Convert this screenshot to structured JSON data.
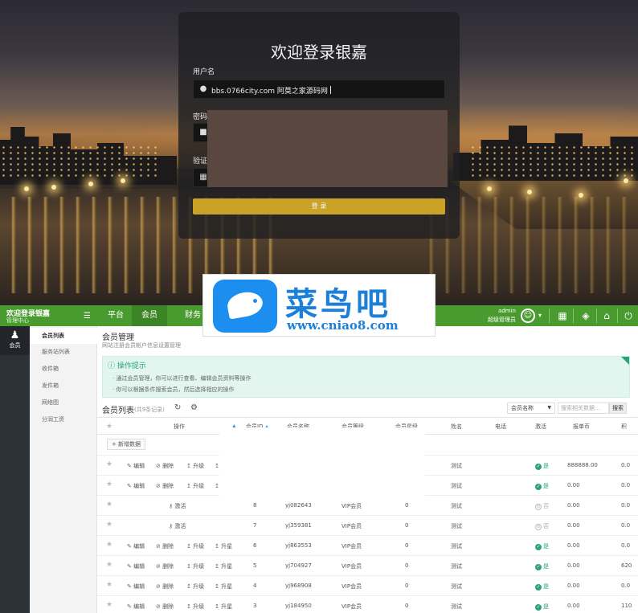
{
  "login": {
    "title": "欢迎登录银嘉",
    "username_label": "用户名",
    "username_value": "bbs.0766city.com   阿莫之家源码网",
    "password_label": "密码",
    "captcha_label": "验证",
    "submit_label": "登 录"
  },
  "watermark": {
    "title": "菜鸟吧",
    "url": "www.cniao8.com"
  },
  "header": {
    "brand_title": "欢迎登录银嘉",
    "brand_sub": "管理中心",
    "tabs": [
      "平台",
      "会员",
      "财务"
    ],
    "active_tab": "会员",
    "user_name": "admin",
    "user_role": "超级管理员"
  },
  "rail": {
    "label": "会员"
  },
  "submenu": {
    "items": [
      "会员列表",
      "服务站列表",
      "收件箱",
      "发件箱",
      "网络图",
      "分润工资"
    ],
    "active": "会员列表"
  },
  "page": {
    "title": "会员管理",
    "subtitle": "网站注册会员帐户信息设置管理",
    "tips_title": "操作提示",
    "tips": [
      "通过会员管理，你可以进行查看、编辑会员资料等操作",
      "你可以根据条件搜索会员，然后选择相应的操作"
    ],
    "list_title": "会员列表",
    "list_count": "(共9条记录)",
    "filter_selected": "会员名称",
    "search_placeholder": "搜索相关数据...",
    "search_button": "搜索",
    "add_button": "新增数据"
  },
  "table": {
    "headers": [
      "操作",
      "会员ID",
      "会员名称",
      "会员等级",
      "会员星级",
      "姓名",
      "电话",
      "激活",
      "报单币",
      "积"
    ],
    "actions": {
      "edit": "编辑",
      "delete": "删除",
      "upgrade": "升级",
      "upstar": "升星",
      "activate": "激活"
    },
    "rows": [
      {
        "id": "",
        "name": "",
        "level": "",
        "star": "",
        "realname": "测试",
        "phone": "",
        "active": "是",
        "bd": "888888.00",
        "jf": "0.0",
        "mode": "full"
      },
      {
        "id": "",
        "name": "",
        "level": "",
        "star": "",
        "realname": "测试",
        "phone": "",
        "active": "是",
        "bd": "0.00",
        "jf": "0.0",
        "mode": "full"
      },
      {
        "id": "8",
        "name": "yj082643",
        "level": "VIP会员",
        "star": "0",
        "realname": "测试",
        "phone": "",
        "active": "否",
        "bd": "0.00",
        "jf": "0.0",
        "mode": "activate"
      },
      {
        "id": "7",
        "name": "yj359381",
        "level": "VIP会员",
        "star": "0",
        "realname": "测试",
        "phone": "",
        "active": "否",
        "bd": "0.00",
        "jf": "0.0",
        "mode": "activate"
      },
      {
        "id": "6",
        "name": "yj863553",
        "level": "VIP会员",
        "star": "0",
        "realname": "测试",
        "phone": "",
        "active": "是",
        "bd": "0.00",
        "jf": "0.0",
        "mode": "full"
      },
      {
        "id": "5",
        "name": "yj704927",
        "level": "VIP会员",
        "star": "0",
        "realname": "测试",
        "phone": "",
        "active": "是",
        "bd": "0.00",
        "jf": "620",
        "mode": "full"
      },
      {
        "id": "4",
        "name": "yj968908",
        "level": "VIP会员",
        "star": "0",
        "realname": "测试",
        "phone": "",
        "active": "是",
        "bd": "0.00",
        "jf": "0.0",
        "mode": "full"
      },
      {
        "id": "3",
        "name": "yj184950",
        "level": "VIP会员",
        "star": "0",
        "realname": "测试",
        "phone": "",
        "active": "是",
        "bd": "0.00",
        "jf": "110",
        "mode": "full"
      }
    ]
  },
  "colors": {
    "brand_green": "#4a9b2f",
    "tip_green": "#2aa37a",
    "login_gold": "#c9a227",
    "watermark_blue": "#1c8ef0"
  }
}
